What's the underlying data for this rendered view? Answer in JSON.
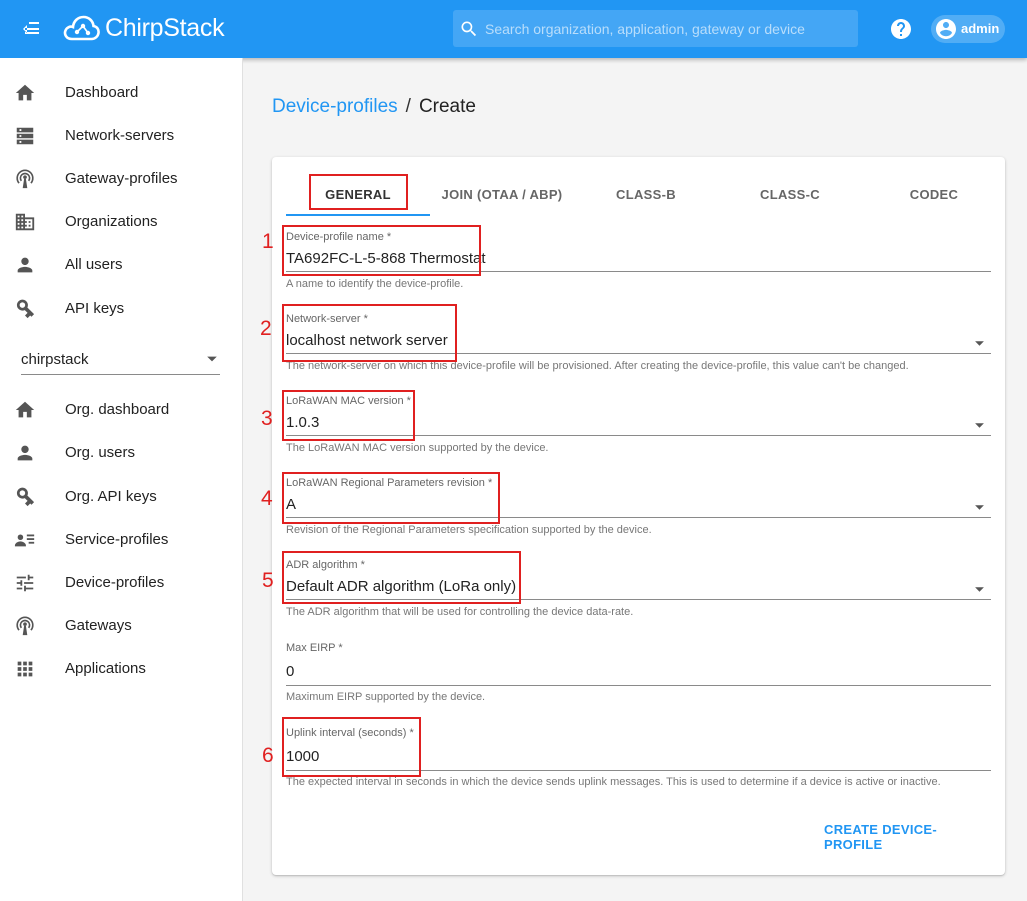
{
  "header": {
    "brand": "ChirpStack",
    "search_placeholder": "Search organization, application, gateway or device",
    "user": "admin",
    "menu_icon": "menu-collapse-icon",
    "help_icon": "help-circle-icon",
    "user_icon": "account-circle-icon"
  },
  "sidebar": {
    "global_items": [
      {
        "label": "Dashboard",
        "icon": "home-icon"
      },
      {
        "label": "Network-servers",
        "icon": "server-icon"
      },
      {
        "label": "Gateway-profiles",
        "icon": "radio-tower-icon"
      },
      {
        "label": "Organizations",
        "icon": "domain-icon"
      },
      {
        "label": "All users",
        "icon": "account-icon"
      },
      {
        "label": "API keys",
        "icon": "key-icon"
      }
    ],
    "org_selector": "chirpstack",
    "org_items": [
      {
        "label": "Org. dashboard",
        "icon": "home-icon"
      },
      {
        "label": "Org. users",
        "icon": "account-icon"
      },
      {
        "label": "Org. API keys",
        "icon": "key-icon"
      },
      {
        "label": "Service-profiles",
        "icon": "account-details-icon"
      },
      {
        "label": "Device-profiles",
        "icon": "tune-icon"
      },
      {
        "label": "Gateways",
        "icon": "radio-tower-icon"
      },
      {
        "label": "Applications",
        "icon": "apps-icon"
      }
    ]
  },
  "breadcrumb": {
    "parent": "Device-profiles",
    "separator": "/",
    "current": "Create"
  },
  "tabs": [
    "GENERAL",
    "JOIN (OTAA / ABP)",
    "CLASS-B",
    "CLASS-C",
    "CODEC"
  ],
  "active_tab": "GENERAL",
  "form": {
    "name": {
      "label": "Device-profile name *",
      "value": "TA692FC-L-5-868 Thermostat",
      "help": "A name to identify the device-profile."
    },
    "network_server": {
      "label": "Network-server *",
      "value": "localhost network server",
      "help": "The network-server on which this device-profile will be provisioned. After creating the device-profile, this value can't be changed."
    },
    "mac_version": {
      "label": "LoRaWAN MAC version *",
      "value": "1.0.3",
      "help": "The LoRaWAN MAC version supported by the device."
    },
    "regional_params": {
      "label": "LoRaWAN Regional Parameters revision *",
      "value": "A",
      "help": "Revision of the Regional Parameters specification supported by the device."
    },
    "adr_algorithm": {
      "label": "ADR algorithm *",
      "value": "Default ADR algorithm (LoRa only)",
      "help": "The ADR algorithm that will be used for controlling the device data-rate."
    },
    "max_eirp": {
      "label": "Max EIRP *",
      "value": "0",
      "help": "Maximum EIRP supported by the device."
    },
    "uplink_interval": {
      "label": "Uplink interval (seconds) *",
      "value": "1000",
      "help": "The expected interval in seconds in which the device sends uplink messages. This is used to determine if a device is active or inactive."
    }
  },
  "submit_label": "CREATE DEVICE-PROFILE",
  "annotations": [
    "1",
    "2",
    "3",
    "4",
    "5",
    "6"
  ],
  "colors": {
    "primary": "#2196f3",
    "annotation": "#e02020"
  }
}
